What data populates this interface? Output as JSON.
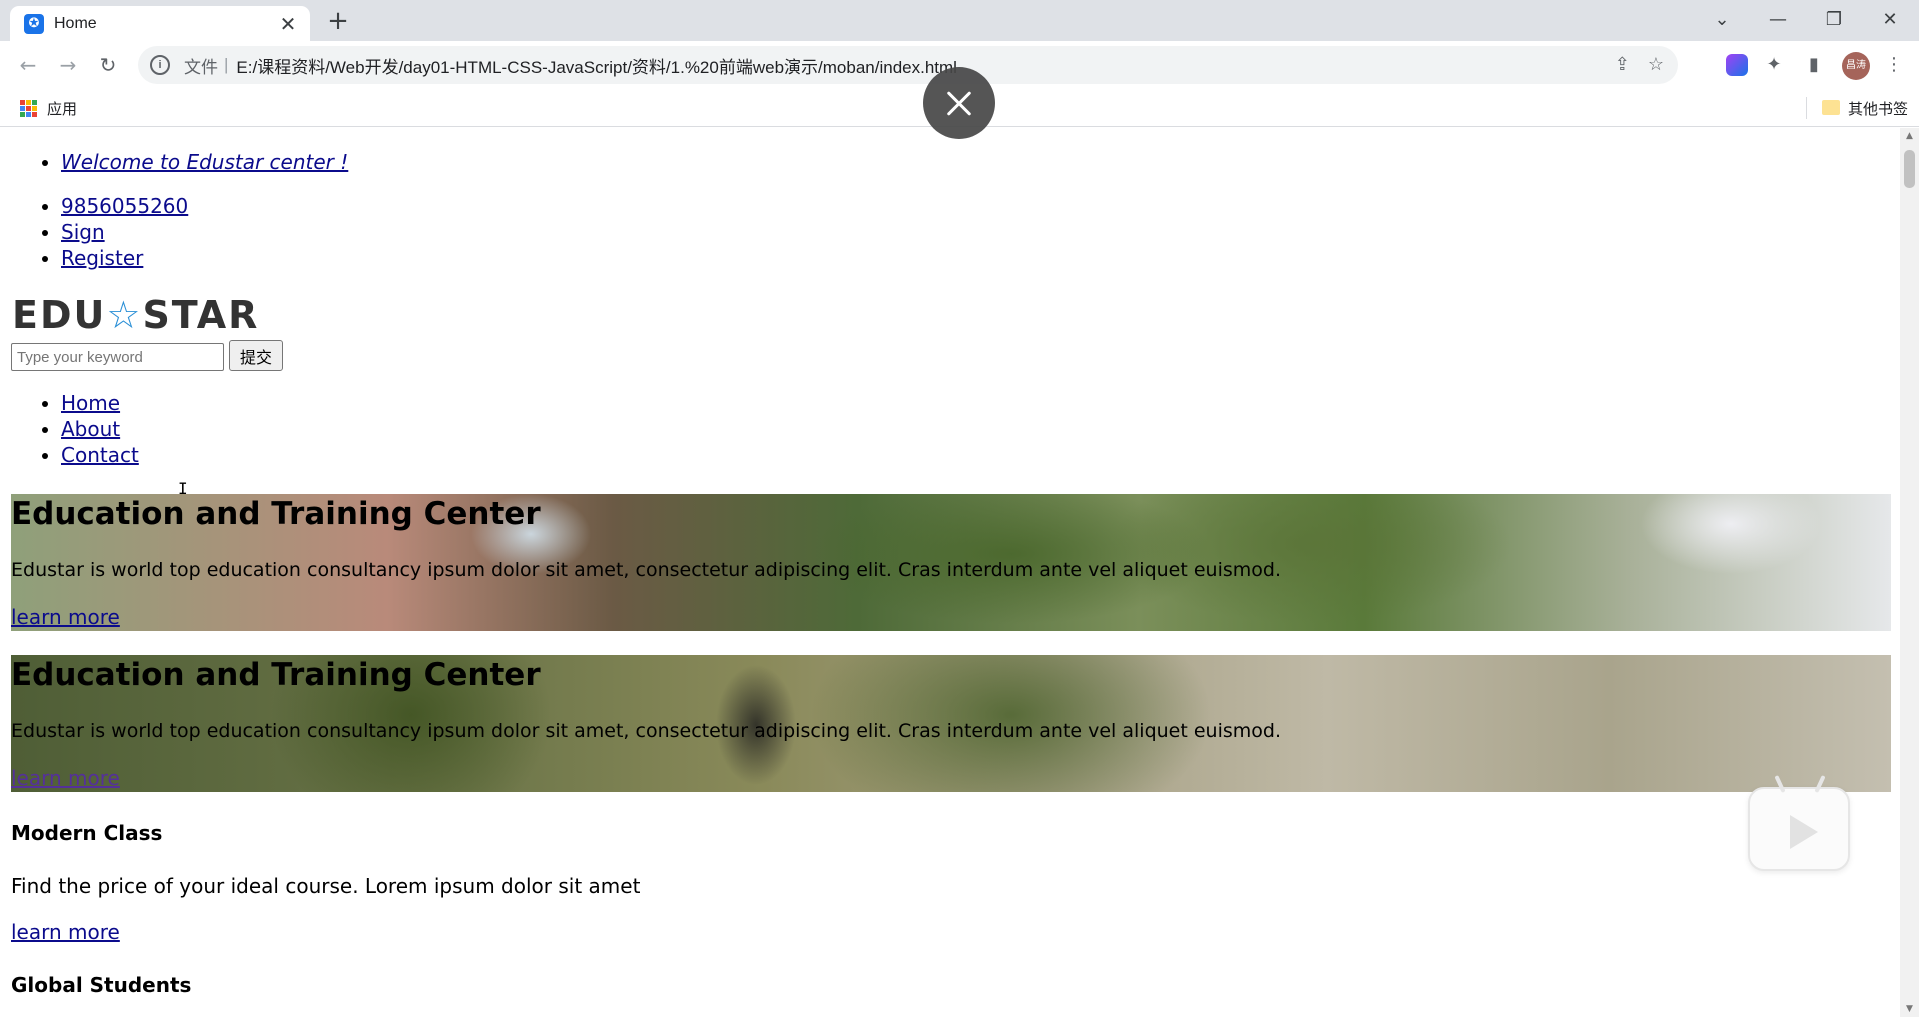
{
  "browser": {
    "tab": {
      "title": "Home",
      "close": "✕"
    },
    "new_tab": "+",
    "window_controls": {
      "chevron": "⌄",
      "minimize": "—",
      "restore": "❐",
      "close": "✕"
    },
    "nav": {
      "back": "←",
      "forward": "→",
      "reload": "↻"
    },
    "omnibox": {
      "info": "i",
      "scheme_label": "文件",
      "separator": "|",
      "url": "E:/课程资料/Web开发/day01-HTML-CSS-JavaScript/资料/1.%20前端web演示/moban/index.html"
    },
    "toolbar_icons": {
      "share": "⇪",
      "bookmark_star": "☆",
      "extensions": "✦",
      "side_panel": "▮",
      "menu": "⋮"
    },
    "profile": {
      "initials": "昌涛"
    },
    "bookmarks": {
      "apps_label": "应用",
      "apps_grid_colors": [
        "#ea4335",
        "#fbbc04",
        "#34a853",
        "#4285f4",
        "#ea4335",
        "#fbbc04",
        "#34a853",
        "#4285f4",
        "#ea4335"
      ],
      "other_label": "其他书签"
    }
  },
  "page": {
    "topbar": {
      "welcome": "Welcome to Edustar center !",
      "phone": "9856055260",
      "sign": "Sign",
      "register": "Register"
    },
    "logo": {
      "left": "EDU",
      "star": "☆",
      "right": "STAR"
    },
    "search": {
      "placeholder": "Type your keyword",
      "submit_label": "提交"
    },
    "nav": {
      "home": "Home",
      "about": "About",
      "contact": "Contact"
    },
    "slides": [
      {
        "title": "Education and Training Center",
        "text": "Edustar is world top education consultancy ipsum dolor sit amet, consectetur adipiscing elit. Cras interdum ante vel aliquet euismod.",
        "link": "learn more"
      },
      {
        "title": "Education and Training Center",
        "text": "Edustar is world top education consultancy ipsum dolor sit amet, consectetur adipiscing elit. Cras interdum ante vel aliquet euismod.",
        "link": "learn more"
      }
    ],
    "features": [
      {
        "title": "Modern Class",
        "text": "Find the price of your ideal course. Lorem ipsum dolor sit amet",
        "link": "learn more"
      },
      {
        "title": "Global Students"
      }
    ]
  }
}
